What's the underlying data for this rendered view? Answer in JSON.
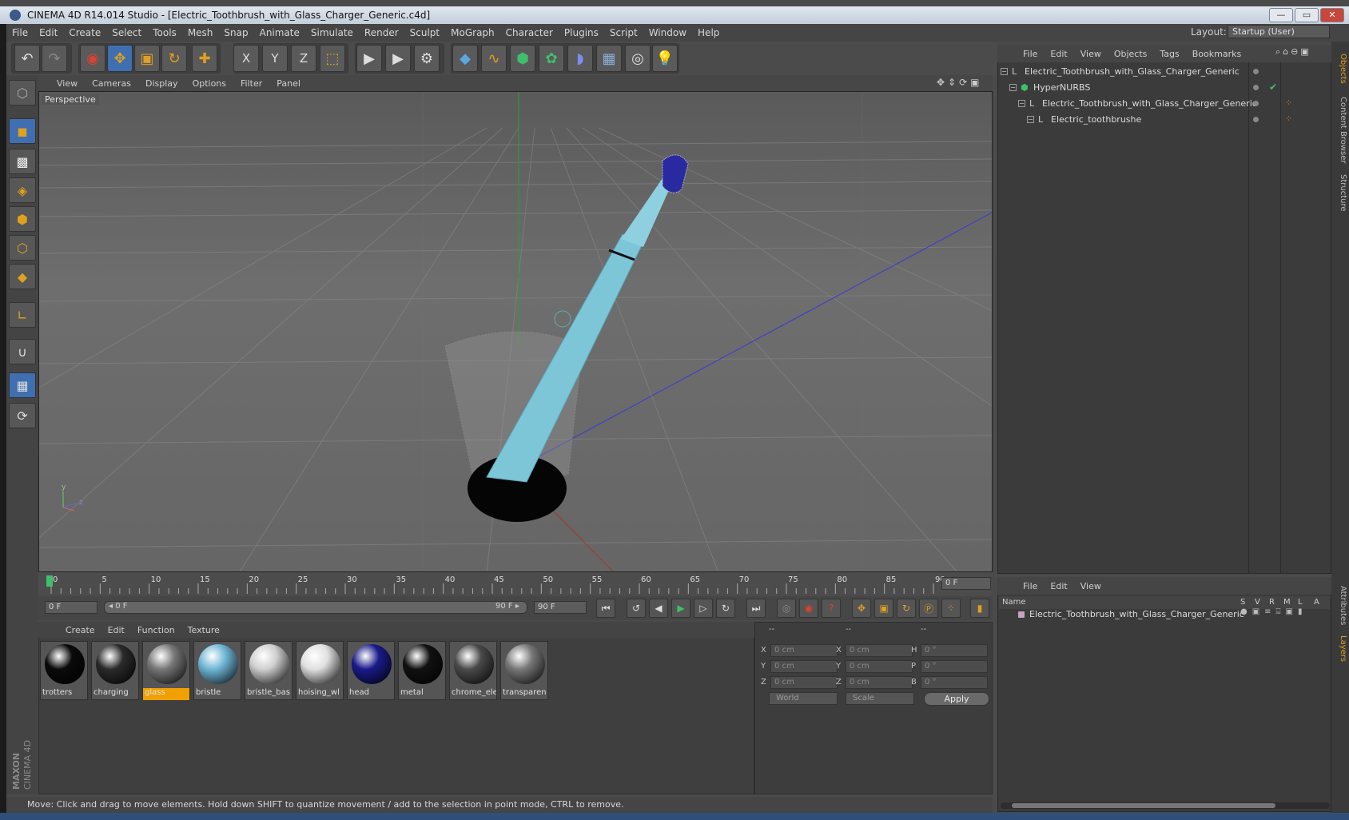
{
  "window": {
    "title": "CINEMA 4D R14.014 Studio - [Electric_Toothbrush_with_Glass_Charger_Generic.c4d]",
    "minimize": "—",
    "maximize": "▭",
    "close": "✕"
  },
  "menubar": {
    "items": [
      "File",
      "Edit",
      "Create",
      "Select",
      "Tools",
      "Mesh",
      "Snap",
      "Animate",
      "Simulate",
      "Render",
      "Sculpt",
      "MoGraph",
      "Character",
      "Plugins",
      "Script",
      "Window",
      "Help"
    ],
    "layout_label": "Layout:",
    "layout_value": "Startup (User)"
  },
  "toolbar": {
    "icons": [
      "undo-icon",
      "redo-icon",
      "live-selection-icon",
      "move-icon",
      "scale-icon",
      "rotate-icon",
      "last-tool-icon",
      "x-axis-lock-icon",
      "y-axis-lock-icon",
      "z-axis-lock-icon",
      "coordinate-system-icon",
      "render-view-icon",
      "render-picture-viewer-icon",
      "edit-render-settings-icon",
      "cube-icon",
      "spline-pen-icon",
      "subdivision-icon",
      "array-icon",
      "deformer-icon",
      "floor-icon",
      "camera-icon",
      "light-icon"
    ],
    "axis_x": "X",
    "axis_y": "Y",
    "axis_z": "Z"
  },
  "viewport": {
    "menu": [
      "View",
      "Cameras",
      "Display",
      "Options",
      "Filter",
      "Panel"
    ],
    "label": "Perspective",
    "axis_y": "y",
    "axis_z": "z"
  },
  "timeline": {
    "ticks": [
      "0",
      "5",
      "10",
      "15",
      "20",
      "25",
      "30",
      "35",
      "40",
      "45",
      "50",
      "55",
      "60",
      "65",
      "70",
      "75",
      "80",
      "85",
      "90"
    ],
    "current_frame": "0 F",
    "start_field": "0 F",
    "range_start": "◂ 0 F",
    "range_end": "90 F ▸",
    "end_field": "90 F"
  },
  "materials": {
    "menu": [
      "Create",
      "Edit",
      "Function",
      "Texture"
    ],
    "items": [
      {
        "label": "trotters",
        "color": "#0a0a0a"
      },
      {
        "label": "charging",
        "color": "#2a2a2a"
      },
      {
        "label": "glass",
        "color": "#777777"
      },
      {
        "label": "bristle",
        "color": "#6fb6d6"
      },
      {
        "label": "bristle_bas",
        "color": "#cfcfcf"
      },
      {
        "label": "hoising_wl",
        "color": "#e0e0e0"
      },
      {
        "label": "head",
        "color": "#1a1a8a"
      },
      {
        "label": "metal",
        "color": "#111111"
      },
      {
        "label": "chrome_ele",
        "color": "#4a4a4a"
      },
      {
        "label": "transparen",
        "color": "#777777"
      }
    ],
    "selected": "glass",
    "selected_color": "#f0a000"
  },
  "attributes": {
    "header": [
      "--",
      "--",
      "--"
    ],
    "rows": [
      {
        "l1": "X",
        "v1": "0 cm",
        "l2": "X",
        "v2": "0 cm",
        "l3": "H",
        "v3": "0 °"
      },
      {
        "l1": "Y",
        "v1": "0 cm",
        "l2": "Y",
        "v2": "0 cm",
        "l3": "P",
        "v3": "0 °"
      },
      {
        "l1": "Z",
        "v1": "0 cm",
        "l2": "Z",
        "v2": "0 cm",
        "l3": "B",
        "v3": "0 °"
      }
    ],
    "coord_mode": "World",
    "scale_mode": "Scale",
    "apply": "Apply"
  },
  "status": "Move: Click and drag to move elements. Hold down SHIFT to quantize movement / add to the selection in point mode, CTRL to remove.",
  "objects": {
    "menu": [
      "File",
      "Edit",
      "View",
      "Objects",
      "Tags",
      "Bookmarks"
    ],
    "tree": [
      {
        "name": "Electric_Toothbrush_with_Glass_Charger_Generic",
        "indent": 0
      },
      {
        "name": "HyperNURBS",
        "indent": 1
      },
      {
        "name": "Electric_Toothbrush_with_Glass_Charger_Generic",
        "indent": 2
      },
      {
        "name": "Electric_toothbrushe",
        "indent": 3
      }
    ]
  },
  "layers": {
    "menu": [
      "File",
      "Edit",
      "View"
    ],
    "col_name": "Name",
    "cols": [
      "S",
      "V",
      "R",
      "M",
      "L",
      "A"
    ],
    "row": "Electric_Toothbrush_with_Glass_Charger_Generic"
  },
  "right_tabs": [
    "Objects",
    "Content Browser",
    "Structure",
    "Attributes",
    "Layers"
  ],
  "brand": {
    "line1": "MAXON",
    "line2": "CINEMA 4D"
  }
}
